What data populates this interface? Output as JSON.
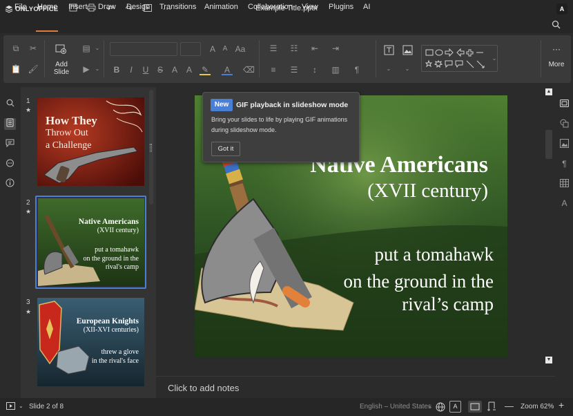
{
  "app": {
    "brand": "ONLYOFFICE",
    "doc_title": "Example Title.pptx",
    "user_initial": "A"
  },
  "menu": [
    "File",
    "Home",
    "Insert",
    "Draw",
    "Design",
    "Transitions",
    "Animation",
    "Collaboration",
    "View",
    "Plugins",
    "AI"
  ],
  "toolbar": {
    "add_slide_line1": "Add",
    "add_slide_line2": "Slide",
    "more": "More"
  },
  "slides": {
    "thumbs": [
      {
        "num": "1",
        "title1": "How They",
        "title2": "Throw Out",
        "title3": "a Challenge"
      },
      {
        "num": "2",
        "title1": "Native Americans",
        "title2": "(XVII century)",
        "body1": "put a tomahawk",
        "body2": "on the ground in the",
        "body3": "rival's camp"
      },
      {
        "num": "3",
        "title1": "European Knights",
        "title2": "(XII-XVI centuries)",
        "body1": "threw a glove",
        "body2": "in the rival's face"
      }
    ]
  },
  "current_slide": {
    "title": "Native Americans",
    "subtitle": "(XVII century)",
    "line1": "put a tomahawk",
    "line2": "on the ground in the",
    "line3": "rival’s camp"
  },
  "notes_placeholder": "Click to add notes",
  "tooltip": {
    "badge": "New",
    "title": "GIF playback in slideshow mode",
    "body": "Bring your slides to life by playing GIF animations during slideshow mode.",
    "button": "Got it"
  },
  "status": {
    "slide_info": "Slide 2 of 8",
    "language": "English – United States",
    "zoom": "Zoom 62%"
  },
  "colors": {
    "accent": "#e47a3d",
    "selection": "#4a7fd6"
  }
}
